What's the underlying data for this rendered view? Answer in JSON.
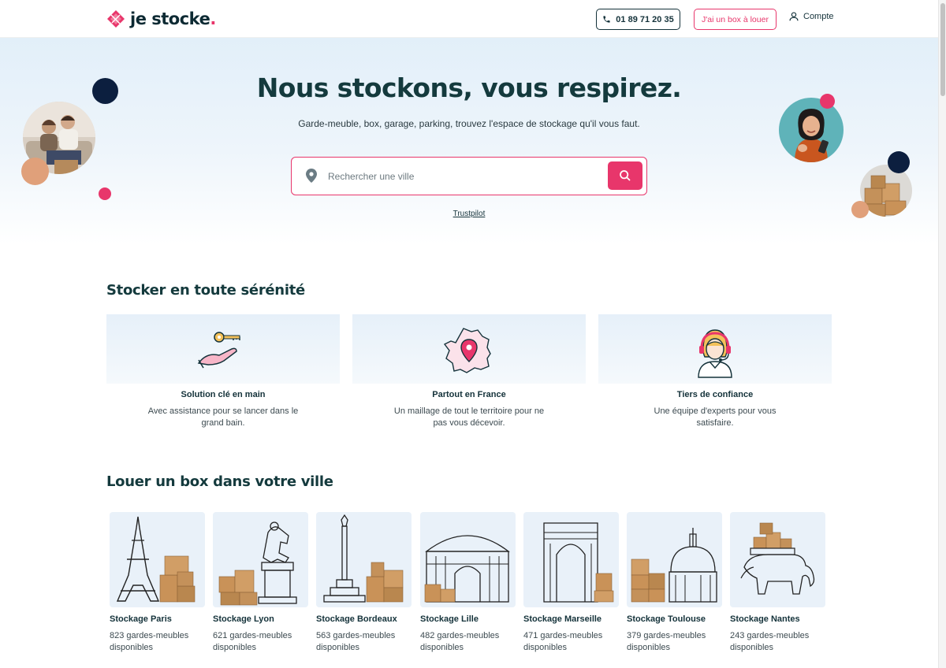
{
  "header": {
    "logo_text": "je stocke",
    "logo_dot": ".",
    "phone": "01 89 71 20 35",
    "owner_button": "J'ai un box à louer",
    "account": "Compte"
  },
  "hero": {
    "title": "Nous stockons, vous respirez.",
    "subtitle": "Garde-meuble, box, garage, parking, trouvez l'espace de stockage qu'il vous faut.",
    "search_placeholder": "Rechercher une ville",
    "trustpilot": "Trustpilot"
  },
  "features_section": {
    "title": "Stocker en toute sérénité",
    "items": [
      {
        "title": "Solution clé en main",
        "desc": "Avec assistance pour se lancer dans le grand bain.",
        "icon": "key-hand-icon"
      },
      {
        "title": "Partout en France",
        "desc": "Un maillage de tout le territoire pour ne pas vous décevoir.",
        "icon": "france-map-pin-icon"
      },
      {
        "title": "Tiers de confiance",
        "desc": "Une équipe d'experts pour vous satisfaire.",
        "icon": "support-agent-icon"
      }
    ]
  },
  "cities_section": {
    "title": "Louer un box dans votre ville",
    "cities": [
      {
        "name": "Stockage Paris",
        "count": "823 gardes-meubles disponibles"
      },
      {
        "name": "Stockage Lyon",
        "count": "621 gardes-meubles disponibles"
      },
      {
        "name": "Stockage Bordeaux",
        "count": "563 gardes-meubles disponibles"
      },
      {
        "name": "Stockage Lille",
        "count": "482 gardes-meubles disponibles"
      },
      {
        "name": "Stockage Marseille",
        "count": "471 gardes-meubles disponibles"
      },
      {
        "name": "Stockage Toulouse",
        "count": "379 gardes-meubles disponibles"
      },
      {
        "name": "Stockage Nantes",
        "count": "243 gardes-meubles disponibles"
      }
    ]
  },
  "colors": {
    "accent": "#e8366b",
    "dark": "#14323a",
    "navy": "#0c1f3f",
    "peach": "#e0a07a"
  }
}
